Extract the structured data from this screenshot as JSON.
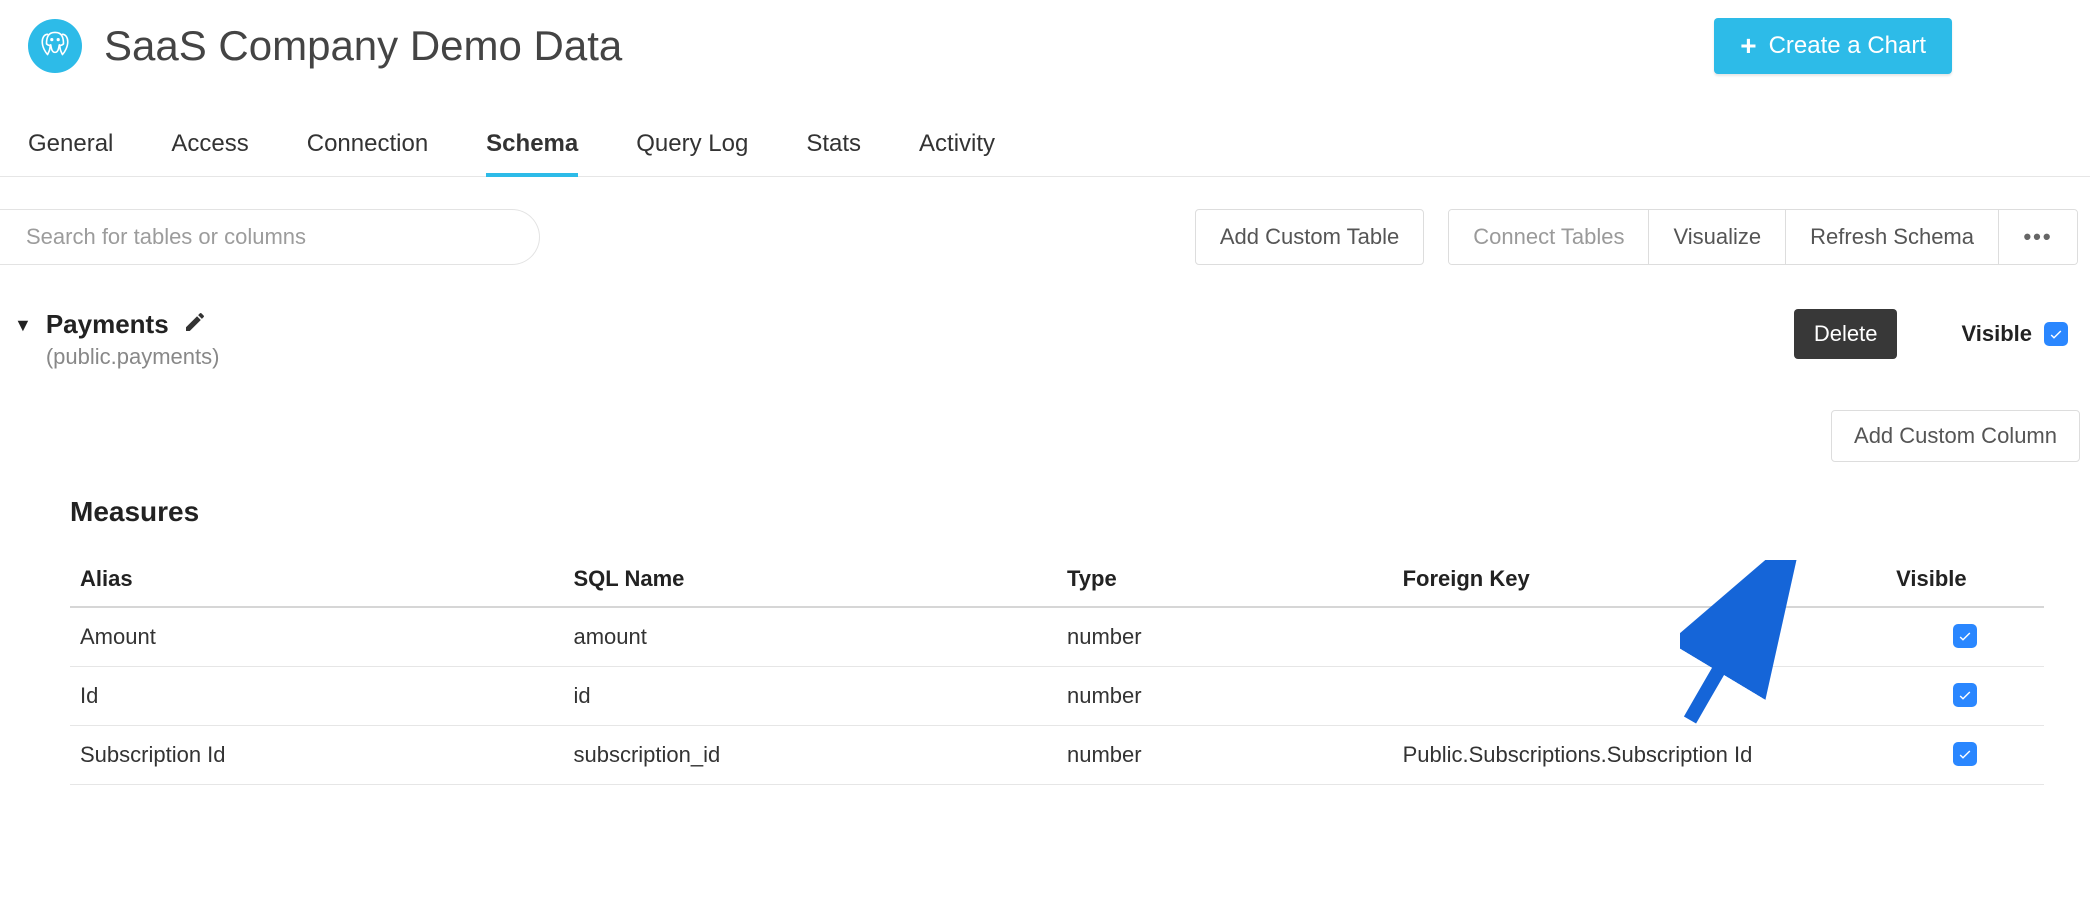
{
  "header": {
    "title": "SaaS Company Demo Data",
    "create_chart_label": "Create a Chart"
  },
  "tabs": [
    {
      "label": "General",
      "active": false
    },
    {
      "label": "Access",
      "active": false
    },
    {
      "label": "Connection",
      "active": false
    },
    {
      "label": "Schema",
      "active": true
    },
    {
      "label": "Query Log",
      "active": false
    },
    {
      "label": "Stats",
      "active": false
    },
    {
      "label": "Activity",
      "active": false
    }
  ],
  "toolbar": {
    "search_placeholder": "Search for tables or columns",
    "add_custom_table": "Add Custom Table",
    "connect_tables": "Connect Tables",
    "visualize": "Visualize",
    "refresh_schema": "Refresh Schema"
  },
  "table_section": {
    "title": "Payments",
    "sub": "(public.payments)",
    "delete_label": "Delete",
    "visible_label": "Visible",
    "visible_checked": true,
    "add_custom_column": "Add Custom Column"
  },
  "measures": {
    "title": "Measures",
    "columns": {
      "alias": "Alias",
      "sql": "SQL Name",
      "type": "Type",
      "fk": "Foreign Key",
      "visible": "Visible"
    },
    "rows": [
      {
        "alias": "Amount",
        "sql": "amount",
        "type": "number",
        "fk": "",
        "visible": true
      },
      {
        "alias": "Id",
        "sql": "id",
        "type": "number",
        "fk": "",
        "visible": true
      },
      {
        "alias": "Subscription Id",
        "sql": "subscription_id",
        "type": "number",
        "fk": "Public.Subscriptions.Subscription Id",
        "visible": true
      }
    ]
  }
}
